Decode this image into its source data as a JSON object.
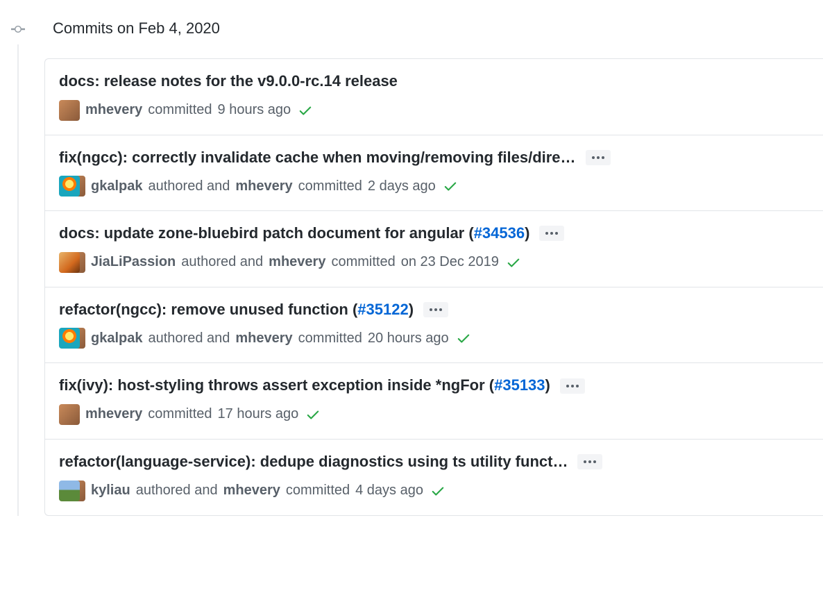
{
  "group_title": "Commits on Feb 4, 2020",
  "expand_label": "...",
  "commits": [
    {
      "title": "docs: release notes for the v9.0.0-rc.14 release",
      "title_suffix": "",
      "pr_ref": "",
      "title_close": "",
      "expand": false,
      "author": "mhevery",
      "has_committer": false,
      "committer": "",
      "meta_mid": "committed",
      "time": "9 hours ago",
      "avatars": [
        "mhevery"
      ],
      "check": true
    },
    {
      "title": "fix(ngcc): correctly invalidate cache when moving/removing files/dire…",
      "title_suffix": "",
      "pr_ref": "",
      "title_close": "",
      "expand": true,
      "author": "gkalpak",
      "has_committer": true,
      "committer": "mhevery",
      "meta_mid": "authored and",
      "meta_tail": "committed",
      "time": "2 days ago",
      "avatars": [
        "gkalpak",
        "mhevery"
      ],
      "check": true
    },
    {
      "title": "docs: update zone-bluebird patch document for angular (",
      "pr_ref": "#34536",
      "title_close": ")",
      "expand": true,
      "author": "JiaLiPassion",
      "has_committer": true,
      "committer": "mhevery",
      "meta_mid": "authored and",
      "meta_tail": "committed",
      "time": "on 23 Dec 2019",
      "avatars": [
        "jiali",
        "mhevery"
      ],
      "check": true
    },
    {
      "title": "refactor(ngcc): remove unused function (",
      "pr_ref": "#35122",
      "title_close": ")",
      "expand": true,
      "author": "gkalpak",
      "has_committer": true,
      "committer": "mhevery",
      "meta_mid": "authored and",
      "meta_tail": "committed",
      "time": "20 hours ago",
      "avatars": [
        "gkalpak",
        "mhevery"
      ],
      "check": true
    },
    {
      "title": "fix(ivy): host-styling throws assert exception inside *ngFor (",
      "pr_ref": "#35133",
      "title_close": ")",
      "expand": true,
      "author": "mhevery",
      "has_committer": false,
      "committer": "",
      "meta_mid": "committed",
      "time": "17 hours ago",
      "avatars": [
        "mhevery"
      ],
      "check": true
    },
    {
      "title": "refactor(language-service): dedupe diagnostics using ts utility funct…",
      "pr_ref": "",
      "title_close": "",
      "expand": true,
      "author": "kyliau",
      "has_committer": true,
      "committer": "mhevery",
      "meta_mid": "authored and",
      "meta_tail": "committed",
      "time": "4 days ago",
      "avatars": [
        "kyliau",
        "mhevery"
      ],
      "check": true
    }
  ],
  "avatar_class": {
    "mhevery": "av-mhevery",
    "gkalpak": "av-gkalpak",
    "jiali": "av-jiali",
    "kyliau": "av-kyliau"
  }
}
